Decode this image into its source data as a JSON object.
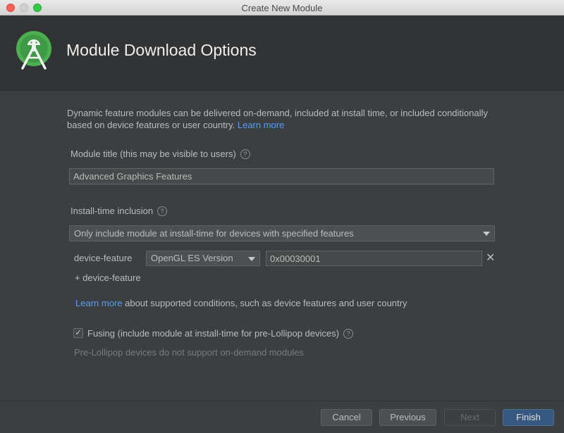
{
  "window": {
    "title": "Create New Module"
  },
  "header": {
    "title": "Module Download Options",
    "logo_icon": "android-studio-logo-icon"
  },
  "description": {
    "text": "Dynamic feature modules can be delivered on-demand, included at install time, or included conditionally based on device features or user country.",
    "link": "Learn more"
  },
  "module_title": {
    "label": "Module title (this may be visible to users)",
    "value": "Advanced Graphics Features"
  },
  "install_time": {
    "label": "Install-time inclusion",
    "selected": "Only include module at install-time for devices with specified features"
  },
  "device_feature": {
    "label": "device-feature",
    "type_selected": "OpenGL ES Version",
    "value": "0x00030001",
    "add_link": "+ device-feature"
  },
  "conditions_note": {
    "link": "Learn more",
    "text": "about supported conditions, such as device features and user country"
  },
  "fusing": {
    "checked": true,
    "label": "Fusing (include module at install-time for pre-Lollipop devices)",
    "note": "Pre-Lollipop devices do not support on-demand modules"
  },
  "buttons": {
    "cancel": "Cancel",
    "previous": "Previous",
    "next": "Next",
    "finish": "Finish"
  },
  "colors": {
    "accent_link": "#589df6",
    "primary_button": "#365880",
    "background": "#3c3f41"
  }
}
